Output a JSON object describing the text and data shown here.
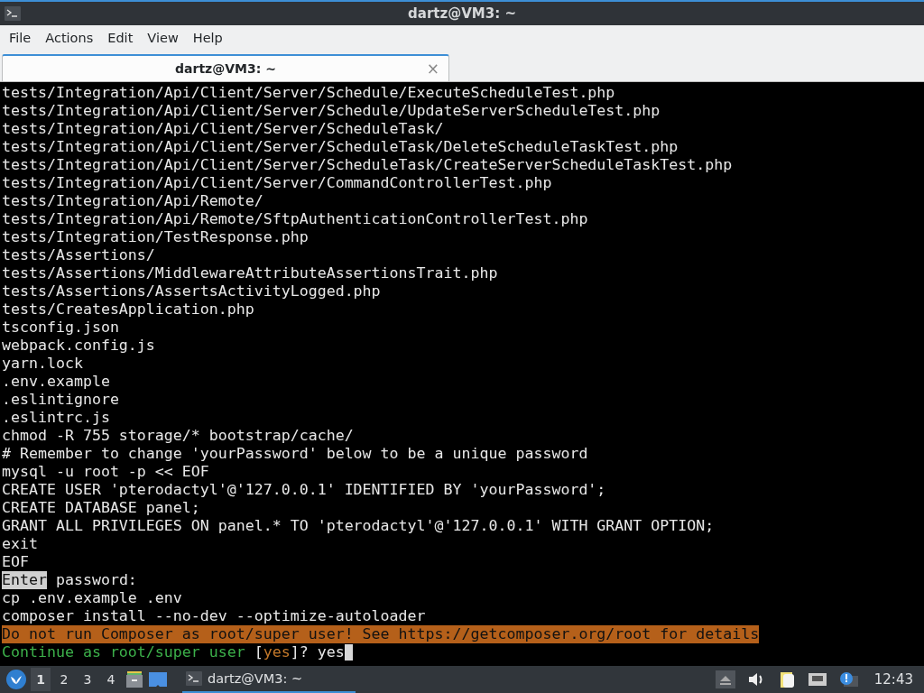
{
  "window": {
    "title": "dartz@VM3: ~"
  },
  "menu": [
    "File",
    "Actions",
    "Edit",
    "View",
    "Help"
  ],
  "tabs": [
    {
      "label": "dartz@VM3: ~",
      "selected": true,
      "close": "×"
    }
  ],
  "terminal": {
    "lines": [
      {
        "segments": [
          {
            "text": "tests/Integration/Api/Client/Server/Schedule/ExecuteScheduleTest.php",
            "kind": "plain"
          }
        ]
      },
      {
        "segments": [
          {
            "text": "tests/Integration/Api/Client/Server/Schedule/UpdateServerScheduleTest.php",
            "kind": "plain"
          }
        ]
      },
      {
        "segments": [
          {
            "text": "tests/Integration/Api/Client/Server/ScheduleTask/",
            "kind": "plain"
          }
        ]
      },
      {
        "segments": [
          {
            "text": "tests/Integration/Api/Client/Server/ScheduleTask/DeleteScheduleTaskTest.php",
            "kind": "plain"
          }
        ]
      },
      {
        "segments": [
          {
            "text": "tests/Integration/Api/Client/Server/ScheduleTask/CreateServerScheduleTaskTest.php",
            "kind": "plain"
          }
        ]
      },
      {
        "segments": [
          {
            "text": "tests/Integration/Api/Client/Server/CommandControllerTest.php",
            "kind": "plain"
          }
        ]
      },
      {
        "segments": [
          {
            "text": "tests/Integration/Api/Remote/",
            "kind": "plain"
          }
        ]
      },
      {
        "segments": [
          {
            "text": "tests/Integration/Api/Remote/SftpAuthenticationControllerTest.php",
            "kind": "plain"
          }
        ]
      },
      {
        "segments": [
          {
            "text": "tests/Integration/TestResponse.php",
            "kind": "plain"
          }
        ]
      },
      {
        "segments": [
          {
            "text": "tests/Assertions/",
            "kind": "plain"
          }
        ]
      },
      {
        "segments": [
          {
            "text": "tests/Assertions/MiddlewareAttributeAssertionsTrait.php",
            "kind": "plain"
          }
        ]
      },
      {
        "segments": [
          {
            "text": "tests/Assertions/AssertsActivityLogged.php",
            "kind": "plain"
          }
        ]
      },
      {
        "segments": [
          {
            "text": "tests/CreatesApplication.php",
            "kind": "plain"
          }
        ]
      },
      {
        "segments": [
          {
            "text": "tsconfig.json",
            "kind": "plain"
          }
        ]
      },
      {
        "segments": [
          {
            "text": "webpack.config.js",
            "kind": "plain"
          }
        ]
      },
      {
        "segments": [
          {
            "text": "yarn.lock",
            "kind": "plain"
          }
        ]
      },
      {
        "segments": [
          {
            "text": ".env.example",
            "kind": "plain"
          }
        ]
      },
      {
        "segments": [
          {
            "text": ".eslintignore",
            "kind": "plain"
          }
        ]
      },
      {
        "segments": [
          {
            "text": ".eslintrc.js",
            "kind": "plain"
          }
        ]
      },
      {
        "segments": [
          {
            "text": "chmod -R 755 storage/* bootstrap/cache/",
            "kind": "plain"
          }
        ]
      },
      {
        "segments": [
          {
            "text": "# Remember to change 'yourPassword' below to be a unique password",
            "kind": "plain"
          }
        ]
      },
      {
        "segments": [
          {
            "text": "mysql -u root -p << EOF",
            "kind": "plain"
          }
        ]
      },
      {
        "segments": [
          {
            "text": "CREATE USER 'pterodactyl'@'127.0.0.1' IDENTIFIED BY 'yourPassword';",
            "kind": "plain"
          }
        ]
      },
      {
        "segments": [
          {
            "text": "CREATE DATABASE panel;",
            "kind": "plain"
          }
        ]
      },
      {
        "segments": [
          {
            "text": "GRANT ALL PRIVILEGES ON panel.* TO 'pterodactyl'@'127.0.0.1' WITH GRANT OPTION;",
            "kind": "plain"
          }
        ]
      },
      {
        "segments": [
          {
            "text": "exit",
            "kind": "plain"
          }
        ]
      },
      {
        "segments": [
          {
            "text": "EOF",
            "kind": "plain"
          }
        ]
      },
      {
        "segments": [
          {
            "text": "Enter",
            "kind": "selected"
          },
          {
            "text": " password:",
            "kind": "plain"
          }
        ]
      },
      {
        "segments": [
          {
            "text": "cp .env.example .env",
            "kind": "plain"
          }
        ]
      },
      {
        "segments": [
          {
            "text": "composer install --no-dev --optimize-autoloader",
            "kind": "plain"
          }
        ]
      },
      {
        "segments": [
          {
            "text": "Do not run Composer as root/super user! See https://getcomposer.org/root for details",
            "kind": "warning"
          }
        ]
      },
      {
        "segments": [
          {
            "text": "Continue as root/super user ",
            "kind": "question"
          },
          {
            "text": "[",
            "kind": "plain"
          },
          {
            "text": "yes",
            "kind": "default"
          },
          {
            "text": "]? yes",
            "kind": "plain"
          }
        ],
        "cursor": true
      }
    ]
  },
  "taskbar": {
    "workspaces": [
      {
        "label": "1",
        "selected": true
      },
      {
        "label": "2",
        "selected": false
      },
      {
        "label": "3",
        "selected": false
      },
      {
        "label": "4",
        "selected": false
      }
    ],
    "task": {
      "label": "dartz@VM3: ~"
    },
    "clock": "12:43"
  }
}
